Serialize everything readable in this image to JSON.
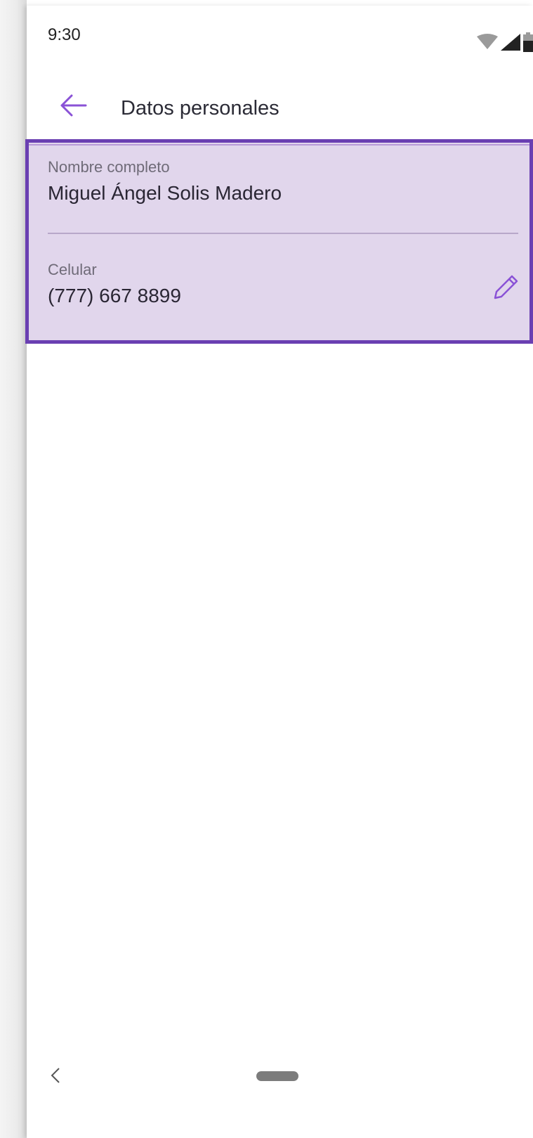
{
  "status_bar": {
    "time": "9:30",
    "icons": [
      "wifi-icon",
      "signal-icon",
      "battery-icon"
    ]
  },
  "app_bar": {
    "title": "Datos personales",
    "back_icon": "arrow-left-icon"
  },
  "fields": {
    "name": {
      "label": "Nombre completo",
      "value": "Miguel Ángel Solis Madero"
    },
    "phone": {
      "label": "Celular",
      "value": "(777) 667 8899",
      "action_icon": "pencil-icon"
    }
  },
  "nav_bar": {
    "back_icon": "chevron-left-icon",
    "home_icon": "home-pill-icon"
  },
  "colors": {
    "accent": "#6a3fb2",
    "card_background": "#e1d6ec",
    "icon_purple": "#8a52d6"
  }
}
